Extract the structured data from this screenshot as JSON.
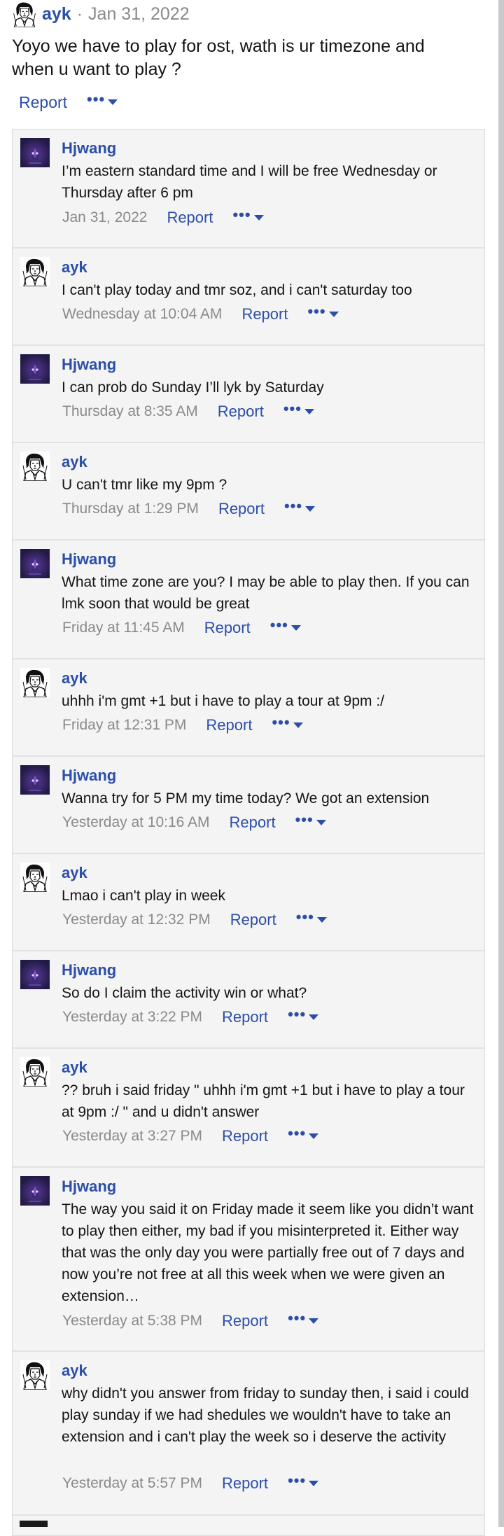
{
  "post": {
    "author": "ayk",
    "separator": "·",
    "date": "Jan 31, 2022",
    "text": "Yoyo we have to play for ost, wath is ur timezone and when u want to play ?",
    "report_label": "Report",
    "more_label": "•••"
  },
  "replies": [
    {
      "author": "Hjwang",
      "avatar": "hjwang",
      "text": "I’m eastern standard time and I will be free Wednesday or Thursday after 6 pm",
      "date": "Jan 31, 2022",
      "report": "Report",
      "more": "•••"
    },
    {
      "author": "ayk",
      "avatar": "ayk",
      "text": "I can't play today and tmr soz, and i can't saturday too",
      "date": "Wednesday at 10:04 AM",
      "report": "Report",
      "more": "•••"
    },
    {
      "author": "Hjwang",
      "avatar": "hjwang",
      "text": "I can prob do Sunday I’ll lyk by Saturday",
      "date": "Thursday at 8:35 AM",
      "report": "Report",
      "more": "•••"
    },
    {
      "author": "ayk",
      "avatar": "ayk",
      "text": "U can't tmr like my 9pm ?",
      "date": "Thursday at 1:29 PM",
      "report": "Report",
      "more": "•••"
    },
    {
      "author": "Hjwang",
      "avatar": "hjwang",
      "text": "What time zone are you? I may be able to play then. If you can lmk soon that would be great",
      "date": "Friday at 11:45 AM",
      "report": "Report",
      "more": "•••"
    },
    {
      "author": "ayk",
      "avatar": "ayk",
      "text": "uhhh i'm gmt +1 but i have to play a tour at 9pm :/",
      "date": "Friday at 12:31 PM",
      "report": "Report",
      "more": "•••"
    },
    {
      "author": "Hjwang",
      "avatar": "hjwang",
      "text": "Wanna try for 5 PM my time today? We got an extension",
      "date": "Yesterday at 10:16 AM",
      "report": "Report",
      "more": "•••"
    },
    {
      "author": "ayk",
      "avatar": "ayk",
      "text": "Lmao i can't play in week",
      "date": "Yesterday at 12:32 PM",
      "report": "Report",
      "more": "•••"
    },
    {
      "author": "Hjwang",
      "avatar": "hjwang",
      "text": "So do I claim the activity win or what?",
      "date": "Yesterday at 3:22 PM",
      "report": "Report",
      "more": "•••"
    },
    {
      "author": "ayk",
      "avatar": "ayk",
      "text": "?? bruh i said friday \" uhhh i'm gmt +1 but i have to play a tour at 9pm :/ \" and u didn't answer",
      "date": "Yesterday at 3:27 PM",
      "report": "Report",
      "more": "•••"
    },
    {
      "author": "Hjwang",
      "avatar": "hjwang",
      "text": "The way you said it on Friday made it seem like you didn’t want to play then either, my bad if you misinterpreted it. Either way that was the only day you were partially free out of 7 days and now you’re not free at all this week when we were given an extension…",
      "date": "Yesterday at 5:38 PM",
      "report": "Report",
      "more": "•••"
    },
    {
      "author": "ayk",
      "avatar": "ayk",
      "text": "why didn't you answer from friday to sunday then, i said i could play sunday if we had shedules we wouldn't have to take an extension and i can't play the week so i deserve the activity",
      "date": "Yesterday at 5:57 PM",
      "report": "Report",
      "more": "•••"
    }
  ],
  "colors": {
    "link": "#2c4ea8",
    "muted": "#8a8a8a",
    "reply_bg": "#f4f4f4",
    "hjwang_avatar_bg": "#2d2150",
    "hjwang_avatar_glow": "#7a4cc2"
  },
  "icons": {
    "ayk_avatar": "sketch-portrait-icon",
    "hjwang_avatar": "purple-figure-icon",
    "more_caret": "caret-down-icon"
  }
}
